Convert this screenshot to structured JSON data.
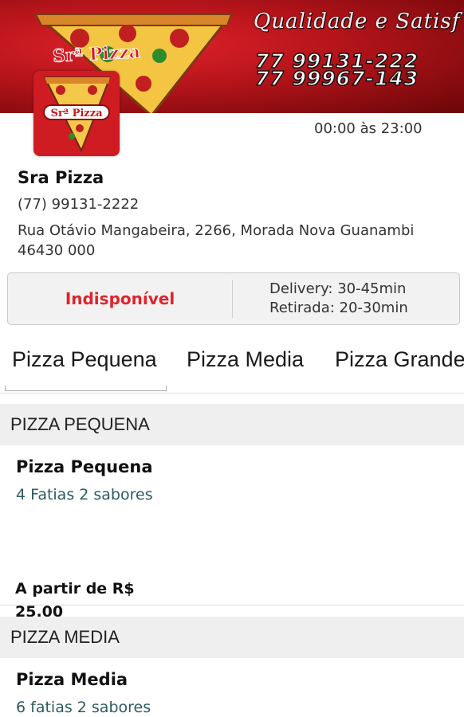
{
  "banner": {
    "slogan": "Qualidade e Satisf",
    "brand": "Srª Pizza",
    "phone1": "77 99131-222",
    "phone2": "77 99967-143"
  },
  "logo": {
    "text": "Srª Pizza"
  },
  "hours": "00:00 às 23:00",
  "info": {
    "name": "Sra Pizza",
    "phone": "(77) 99131-2222",
    "address": "Rua Otávio Mangabeira, 2266, Morada Nova Guanambi 46430 000"
  },
  "status": {
    "availability": "Indisponível",
    "delivery": "Delivery: 30-45min",
    "pickup": "Retirada: 20-30min"
  },
  "tabs": [
    "Pizza Pequena",
    "Pizza Media",
    "Pizza Grande"
  ],
  "sections": [
    {
      "header": "PIZZA PEQUENA",
      "item": {
        "title": "Pizza Pequena",
        "description": "4 Fatias 2 sabores",
        "price_label": "A partir de R$",
        "price": "25.00"
      }
    },
    {
      "header": "PIZZA MEDIA",
      "item": {
        "title": "Pizza Media",
        "description": "6 fatias 2 sabores"
      }
    }
  ],
  "colors": {
    "brand_red": "#cf1c22",
    "unavailable": "#e0232a"
  }
}
